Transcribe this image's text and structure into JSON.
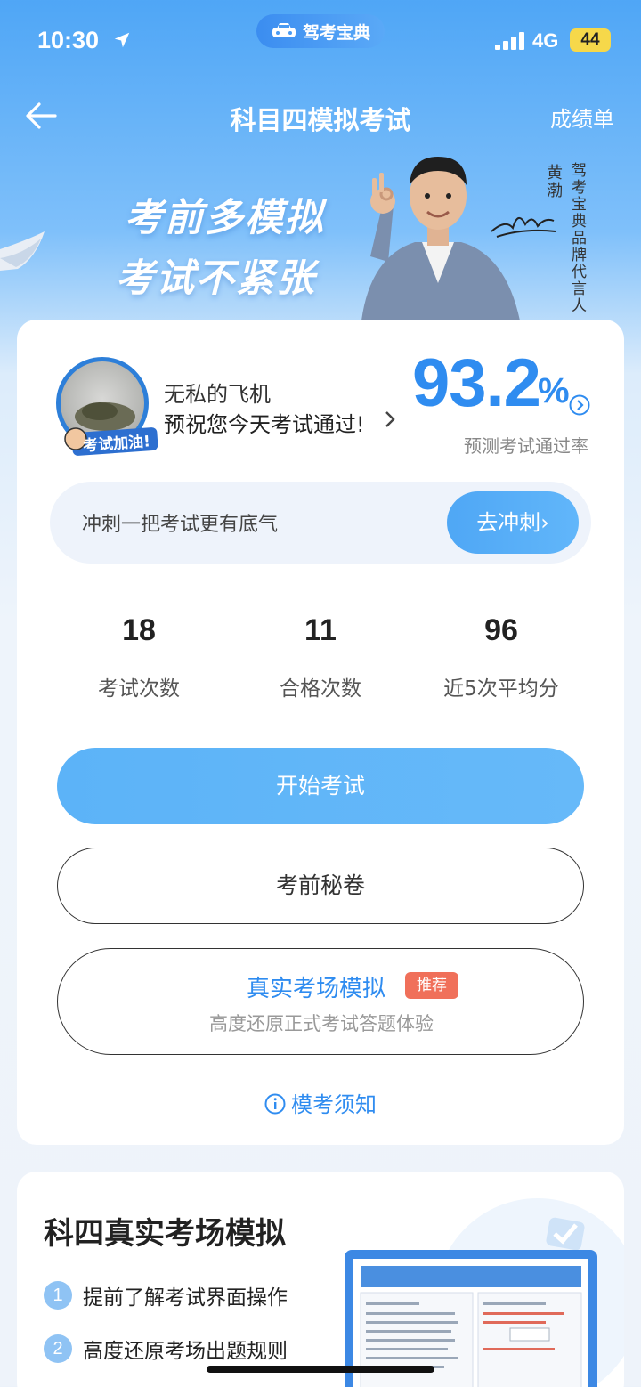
{
  "status_bar": {
    "time": "10:30",
    "app_pill": "驾考宝典",
    "network": "4G",
    "battery": "44"
  },
  "nav": {
    "title": "科目四模拟考试",
    "right_link": "成绩单"
  },
  "banner": {
    "slogan_line1": "考前多模拟",
    "slogan_line2": "考试不紧张",
    "spokesperson_name": "黄渤",
    "spokesperson_title": "驾考宝典品牌代言人"
  },
  "profile": {
    "avatar_badge": "考试加油!",
    "username": "无私的飞机",
    "wish": "预祝您今天考试通过!",
    "pass_rate": "93.2",
    "pass_rate_unit": "%",
    "pass_rate_caption": "预测考试通过率"
  },
  "sprint": {
    "text": "冲刺一把考试更有底气",
    "button": "去冲刺"
  },
  "stats": [
    {
      "value": "18",
      "label": "考试次数"
    },
    {
      "value": "11",
      "label": "合格次数"
    },
    {
      "value": "96",
      "label": "近5次平均分"
    }
  ],
  "buttons": {
    "start": "开始考试",
    "secret": "考前秘卷",
    "real_title": "真实考场模拟",
    "real_badge": "推荐",
    "real_sub": "高度还原正式考试答题体验",
    "notice": "模考须知"
  },
  "real_section": {
    "title": "科四真实考场模拟",
    "features": [
      {
        "num": "1",
        "text": "提前了解考试界面操作"
      },
      {
        "num": "2",
        "text": "高度还原考场出题规则"
      }
    ]
  },
  "colors": {
    "brand_blue": "#2f8cf0",
    "button_blue": "#5cb3f8",
    "badge_red": "#f0705a",
    "battery_yellow": "#f6d84a"
  }
}
